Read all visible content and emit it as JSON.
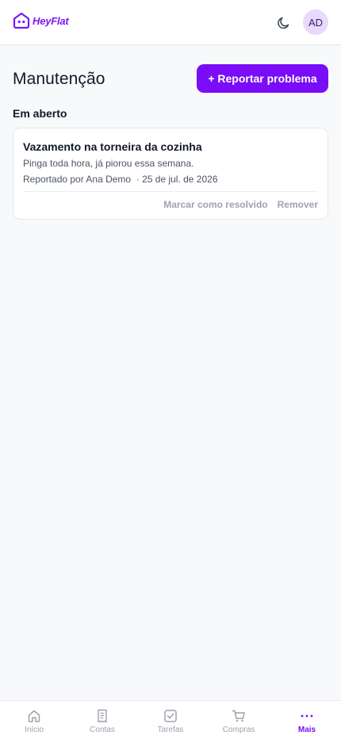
{
  "app": {
    "brand": "HeyFlat",
    "brand_color": "#7a0cf7",
    "theme_toggle_icon": "moon-icon"
  },
  "user": {
    "initials": "AD"
  },
  "page": {
    "title": "Manutenção",
    "report_button": "+ Reportar problema"
  },
  "sections": {
    "open": {
      "title": "Em aberto",
      "items": [
        {
          "title": "Vazamento na torneira da cozinha",
          "description": "Pinga toda hora, já piorou essa semana.",
          "meta": "Reportado por Ana Demo  · 25 de jul. de 2026",
          "resolve_label": "Marcar como resolvido",
          "remove_label": "Remover"
        }
      ]
    }
  },
  "nav": {
    "items": [
      {
        "label": "Início",
        "icon": "home-icon",
        "active": false
      },
      {
        "label": "Contas",
        "icon": "receipt-icon",
        "active": false
      },
      {
        "label": "Tarefas",
        "icon": "checkbox-icon",
        "active": false
      },
      {
        "label": "Compras",
        "icon": "cart-icon",
        "active": false
      },
      {
        "label": "Mais",
        "icon": "more-icon",
        "active": true
      }
    ]
  }
}
